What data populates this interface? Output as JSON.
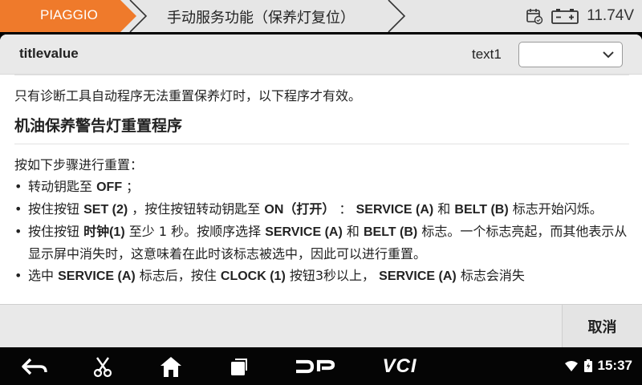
{
  "topbar": {
    "brand": "PIAGGIO",
    "title": "手动服务功能（保养灯复位）",
    "voltage": "11.74V",
    "icons": [
      "calendar-sync-icon",
      "battery-icon"
    ]
  },
  "dialog": {
    "title": "titlevalue",
    "text1": "text1",
    "select_value": "",
    "intro": "只有诊断工具自动程序无法重置保养灯时，以下程序才有效。",
    "heading": "机油保养警告灯重置程序",
    "steps_intro": "按如下步骤进行重置：",
    "bullets": [
      {
        "parts": [
          "转动钥匙至 ",
          "OFF",
          " ；"
        ]
      },
      {
        "parts": [
          "按住按钮 ",
          "SET (2)",
          " ，按住按钮转动钥匙至 ",
          "ON（打开）",
          " ： ",
          "SERVICE (A)",
          " 和 ",
          "BELT (B)",
          " 标志开始闪烁。"
        ]
      },
      {
        "parts": [
          "按住按钮 ",
          "时钟(1)",
          " 至少 1 秒。按顺序选择 ",
          "SERVICE (A)",
          " 和 ",
          "BELT (B)",
          " 标志。一个标志亮起，而其他表示从显示屏中消失时，这意味着在此时该标志被选中，因此可以进行重置。"
        ]
      },
      {
        "parts": [
          "选中 ",
          "SERVICE (A)",
          " 标志后，按住 ",
          "CLOCK (1)",
          " 按钮3秒以上， ",
          "SERVICE (A)",
          " 标志会消失"
        ]
      }
    ]
  },
  "buttons": {
    "cancel": "取消"
  },
  "navbar": {
    "dp_label": "DP",
    "vci_label": "VCI",
    "time": "15:37"
  }
}
